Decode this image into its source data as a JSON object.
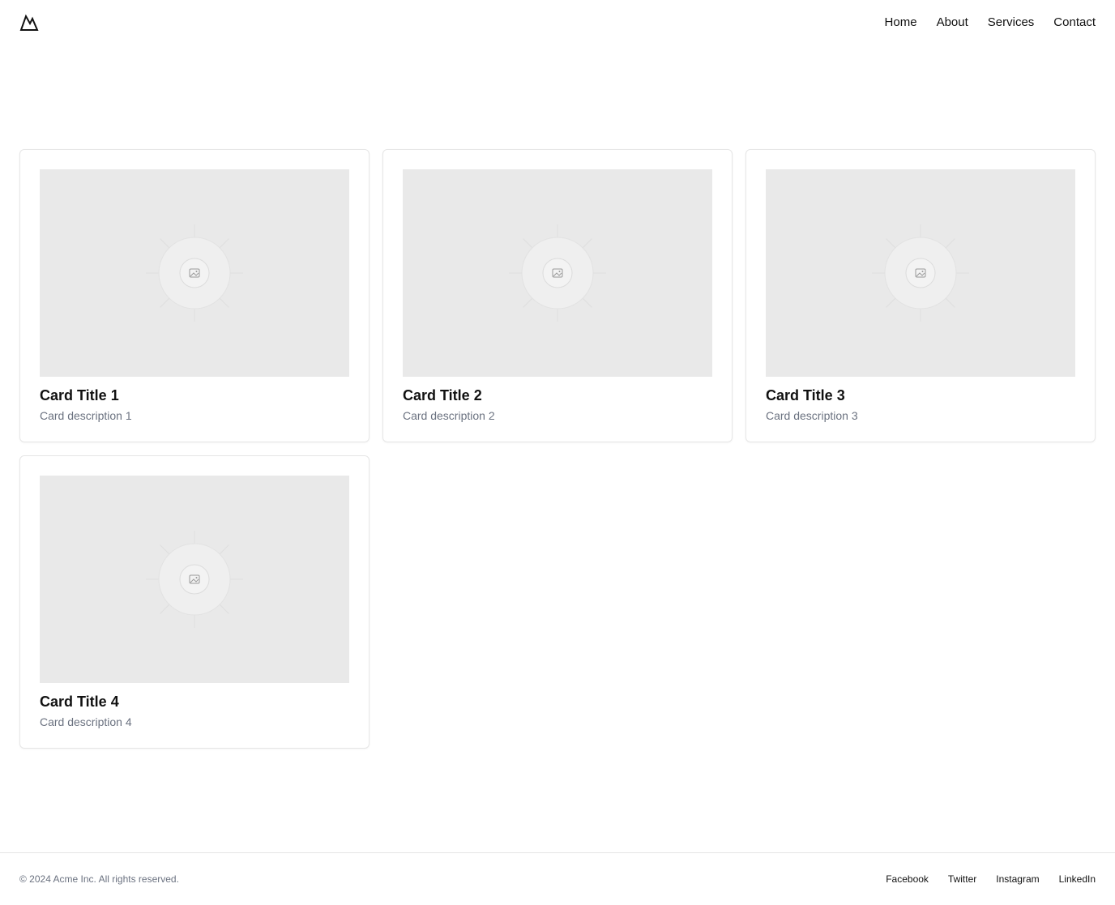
{
  "header": {
    "logo_icon": "mountain-logo-icon",
    "nav": [
      {
        "label": "Home"
      },
      {
        "label": "About"
      },
      {
        "label": "Services"
      },
      {
        "label": "Contact"
      }
    ]
  },
  "cards": [
    {
      "title": "Card Title 1",
      "description": "Card description 1",
      "image_icon": "image-placeholder-icon"
    },
    {
      "title": "Card Title 2",
      "description": "Card description 2",
      "image_icon": "image-placeholder-icon"
    },
    {
      "title": "Card Title 3",
      "description": "Card description 3",
      "image_icon": "image-placeholder-icon"
    },
    {
      "title": "Card Title 4",
      "description": "Card description 4",
      "image_icon": "image-placeholder-icon"
    }
  ],
  "footer": {
    "copyright": "© 2024 Acme Inc. All rights reserved.",
    "links": [
      {
        "label": "Facebook"
      },
      {
        "label": "Twitter"
      },
      {
        "label": "Instagram"
      },
      {
        "label": "LinkedIn"
      }
    ]
  },
  "colors": {
    "placeholder_bg": "#e9e9e9",
    "muted_text": "#6b7280",
    "border": "#e6e6e6"
  }
}
